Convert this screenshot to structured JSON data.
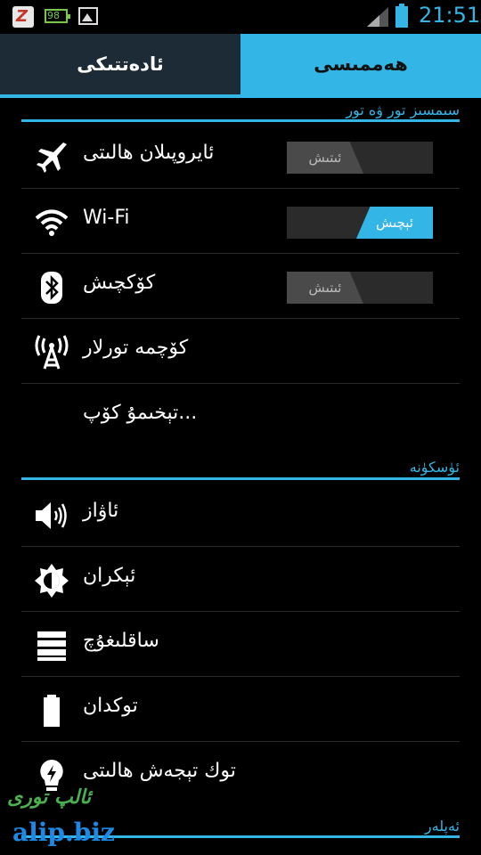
{
  "status_bar": {
    "notif_z": "Z",
    "notif_battery": "98",
    "time": "21:51",
    "icons": [
      "z-app-icon",
      "battery-98-icon",
      "image-icon",
      "signal-icon",
      "battery-icon"
    ]
  },
  "tabs": [
    {
      "label": "ئادەتتىكى",
      "selected": false
    },
    {
      "label": "ھەممىسى",
      "selected": true
    }
  ],
  "sections": {
    "wireless": {
      "title": "سىمسىز تور ۋە تور"
    },
    "device": {
      "title": "ئۈسكۈنە"
    },
    "personal": {
      "title": "ئەپلەر"
    }
  },
  "wireless_items": [
    {
      "label": "ئايروپىلان ھالىتى",
      "icon": "airplane-icon",
      "toggle": "ئىتىش"
    },
    {
      "label": "Wi-Fi",
      "icon": "wifi-icon",
      "toggle": "ئېچىش"
    },
    {
      "label": "كۆكچىش",
      "icon": "bluetooth-icon",
      "toggle": "ئىتىش"
    },
    {
      "label": "كۆچمە تورلار",
      "icon": "cell-tower-icon"
    },
    {
      "label": "تېخىمۇ كۆپ...",
      "icon": ""
    }
  ],
  "device_items": [
    {
      "label": "ئاۋاز",
      "icon": "speaker-icon"
    },
    {
      "label": "ئېكران",
      "icon": "brightness-icon"
    },
    {
      "label": "ساقلىغۇچ",
      "icon": "storage-icon"
    },
    {
      "label": "توكدان",
      "icon": "battery-icon"
    },
    {
      "label": "توك تېجەش ھالىتى",
      "icon": "lightbulb-icon"
    }
  ],
  "watermark": {
    "line1": "ئالپ تورى",
    "line2": "alip.biz"
  },
  "accent_color": "#33b5e5"
}
